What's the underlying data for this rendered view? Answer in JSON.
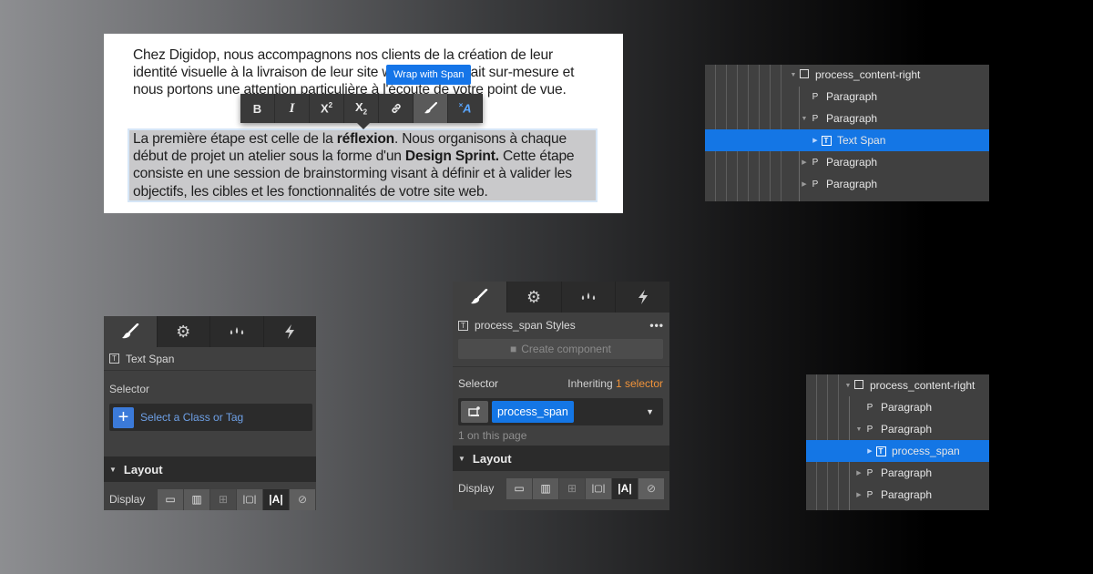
{
  "editor": {
    "paragraph1": "Chez Digidop, nous accompagnons nos clients de la création de leur identité visuelle à la livraison de leur site web. Tout est fait sur-mesure et nous portons une attention particulière à l'écoute de votre point de vue.",
    "paragraph2": {
      "part1": "La première étape est celle de la ",
      "bold1": "réflexion",
      "part2": ". Nous organisons à chaque début de projet un atelier sous la forme d'un ",
      "bold2": "Design Sprint.",
      "part3": " Cette étape consiste en une session de brainstorming visant à définir et à valider les objectifs, les cibles et les fonctionnalités de votre site web."
    },
    "tooltip": "Wrap with Span",
    "toolbar": [
      {
        "name": "bold-button",
        "label": "B"
      },
      {
        "name": "italic-button",
        "label": "I"
      },
      {
        "name": "superscript-button",
        "label": "X",
        "sup": "2"
      },
      {
        "name": "subscript-button",
        "label": "X",
        "sub": "2"
      },
      {
        "name": "link-button",
        "label": "🔗",
        "icon": "link-icon"
      },
      {
        "name": "style-brush-button",
        "label": "🖌",
        "icon": "brush-icon",
        "active": true
      },
      {
        "name": "clear-format-button",
        "label": "×A",
        "icon": "clear-format-icon"
      }
    ]
  },
  "navigator1": {
    "items": [
      {
        "label": "process_content-right",
        "icon": "div-box-icon",
        "expanded": true,
        "depth": 0
      },
      {
        "label": "Paragraph",
        "icon": "paragraph-icon",
        "glyph": "P",
        "depth": 1,
        "hasChildren": false
      },
      {
        "label": "Paragraph",
        "icon": "paragraph-icon",
        "glyph": "P",
        "depth": 1,
        "expanded": true
      },
      {
        "label": "Text Span",
        "icon": "text-span-icon",
        "glyph": "T",
        "depth": 2,
        "selected": true
      },
      {
        "label": "Paragraph",
        "icon": "paragraph-icon",
        "glyph": "P",
        "depth": 1
      },
      {
        "label": "Paragraph",
        "icon": "paragraph-icon",
        "glyph": "P",
        "depth": 1
      }
    ]
  },
  "navigator2": {
    "items": [
      {
        "label": "process_content-right",
        "icon": "div-box-icon",
        "expanded": true,
        "depth": 0
      },
      {
        "label": "Paragraph",
        "icon": "paragraph-icon",
        "glyph": "P",
        "depth": 1,
        "hasChildren": false
      },
      {
        "label": "Paragraph",
        "icon": "paragraph-icon",
        "glyph": "P",
        "depth": 1,
        "expanded": true
      },
      {
        "label": "process_span",
        "icon": "text-span-icon",
        "glyph": "T",
        "depth": 2,
        "selected": true
      },
      {
        "label": "Paragraph",
        "icon": "paragraph-icon",
        "glyph": "P",
        "depth": 1
      },
      {
        "label": "Paragraph",
        "icon": "paragraph-icon",
        "glyph": "P",
        "depth": 1
      }
    ]
  },
  "tabs": [
    {
      "icon": "brush-icon",
      "glyph": "🖌",
      "active": true
    },
    {
      "icon": "gear-icon",
      "glyph": "⚙"
    },
    {
      "icon": "drops-icon",
      "glyph": "💧"
    },
    {
      "icon": "lightning-icon",
      "glyph": "⚡"
    }
  ],
  "panel1": {
    "element_name": "Text Span",
    "element_glyph": "T",
    "selector_label": "Selector",
    "selector_placeholder": "Select a Class or Tag",
    "plus": "+",
    "layout_label": "Layout",
    "display_label": "Display"
  },
  "panel2": {
    "element_name": "process_span Styles",
    "element_glyph": "T",
    "more": "•••",
    "create_component": "Create component",
    "selector_label": "Selector",
    "inheriting_prefix": "Inheriting ",
    "inheriting_link": "1 selector",
    "class_name": "process_span",
    "page_count": "1 on this page",
    "layout_label": "Layout",
    "display_label": "Display"
  },
  "display_options": [
    {
      "name": "display-block-button",
      "glyph": "▭"
    },
    {
      "name": "display-flex-button",
      "glyph": "▥"
    },
    {
      "name": "display-grid-button",
      "glyph": "⊞",
      "dim": true
    },
    {
      "name": "display-inline-block-button",
      "glyph": "|▢|"
    },
    {
      "name": "display-inline-button",
      "glyph": "|A|",
      "active": true
    },
    {
      "name": "display-none-button",
      "glyph": "⊘",
      "hidden": true
    }
  ],
  "colors": {
    "accent_blue": "#1476e5",
    "inherit_orange": "#f0933a",
    "panel_bg": "#404040",
    "panel_dark": "#2b2b2b"
  }
}
